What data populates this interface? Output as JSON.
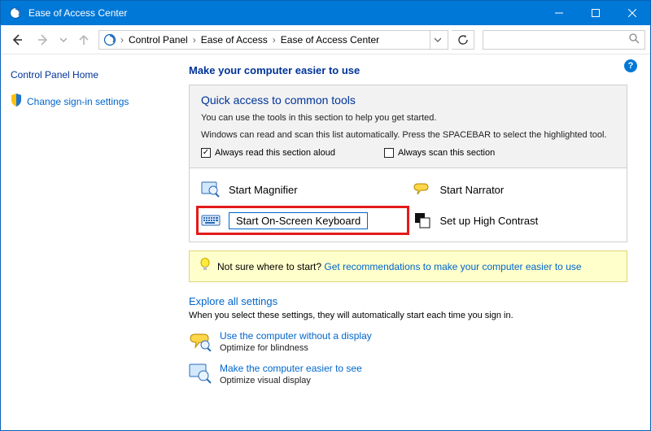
{
  "titlebar": {
    "title": "Ease of Access Center"
  },
  "breadcrumb": {
    "items": [
      "Control Panel",
      "Ease of Access",
      "Ease of Access Center"
    ]
  },
  "search": {
    "placeholder": ""
  },
  "sidebar": {
    "home": "Control Panel Home",
    "change_signin": "Change sign-in settings"
  },
  "main": {
    "heading": "Make your computer easier to use",
    "panel": {
      "title": "Quick access to common tools",
      "line1": "You can use the tools in this section to help you get started.",
      "line2": "Windows can read and scan this list automatically.  Press the SPACEBAR to select the highlighted tool.",
      "check1_label": "Always read this section aloud",
      "check1_checked": true,
      "check2_label": "Always scan this section",
      "check2_checked": false
    },
    "tools": {
      "magnifier": "Start Magnifier",
      "narrator": "Start Narrator",
      "osk": "Start On-Screen Keyboard",
      "contrast": "Set up High Contrast"
    },
    "tip": {
      "prefix": "Not sure where to start? ",
      "link": "Get recommendations to make your computer easier to use"
    },
    "explore": {
      "heading": "Explore all settings",
      "sub": "When you select these settings, they will automatically start each time you sign in.",
      "items": [
        {
          "link": "Use the computer without a display",
          "desc": "Optimize for blindness"
        },
        {
          "link": "Make the computer easier to see",
          "desc": "Optimize visual display"
        }
      ]
    }
  },
  "help_glyph": "?"
}
